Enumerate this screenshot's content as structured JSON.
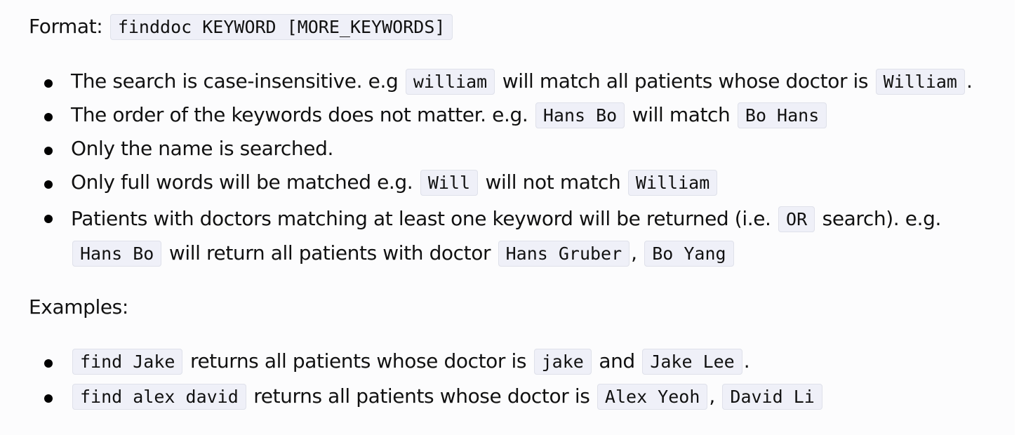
{
  "format": {
    "label": "Format:",
    "syntax": "finddoc KEYWORD [MORE_KEYWORDS]"
  },
  "notes": [
    {
      "t1": "The search is case-insensitive. e.g ",
      "c1": "william",
      "t2": " will match all patients whose doctor is ",
      "c2": "William",
      "t3": "."
    },
    {
      "t1": "The order of the keywords does not matter. e.g. ",
      "c1": "Hans Bo",
      "t2": " will match ",
      "c2": "Bo Hans"
    },
    {
      "t1": "Only the name is searched."
    },
    {
      "t1": "Only full words will be matched e.g. ",
      "c1": "Will",
      "t2": " will not match ",
      "c2": "William"
    },
    {
      "t1": "Patients with doctors matching at least one keyword will be returned (i.e. ",
      "c1": "OR",
      "t2": " search). e.g. ",
      "c2": "Hans Bo",
      "t3": " will return all patients with doctor ",
      "c3": "Hans Gruber",
      "t4": ", ",
      "c4": "Bo Yang"
    }
  ],
  "examples_heading": "Examples:",
  "examples": [
    {
      "c1": "find Jake",
      "t1": " returns all patients whose doctor is ",
      "c2": "jake",
      "t2": " and ",
      "c3": "Jake Lee",
      "t3": "."
    },
    {
      "c1": "find alex david",
      "t1": " returns all patients whose doctor is ",
      "c2": "Alex Yeoh",
      "t2": ", ",
      "c3": "David Li"
    }
  ]
}
